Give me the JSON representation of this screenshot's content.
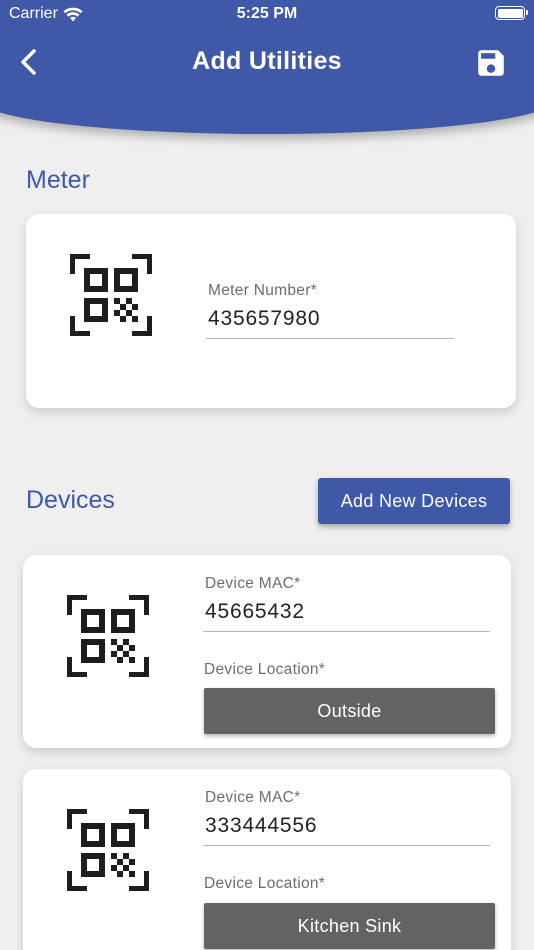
{
  "status_bar": {
    "carrier": "Carrier",
    "time": "5:25 PM"
  },
  "header": {
    "title": "Add Utilities",
    "back_icon": "chevron-left-icon",
    "save_icon": "floppy-disk-icon"
  },
  "meter": {
    "section_title": "Meter",
    "field_label": "Meter Number*",
    "field_value": "435657980",
    "icon": "qr-code-scan-icon"
  },
  "devices": {
    "section_title": "Devices",
    "add_button_label": "Add New Devices",
    "items": [
      {
        "mac_label": "Device MAC*",
        "mac_value": "45665432",
        "location_label": "Device Location*",
        "location_value": "Outside",
        "icon": "qr-code-scan-icon"
      },
      {
        "mac_label": "Device MAC*",
        "mac_value": "333444556",
        "location_label": "Device Location*",
        "location_value": "Kitchen Sink",
        "icon": "qr-code-scan-icon"
      }
    ]
  },
  "colors": {
    "primary": "#3f58a8",
    "background": "#efefef",
    "location_button": "#636363"
  }
}
